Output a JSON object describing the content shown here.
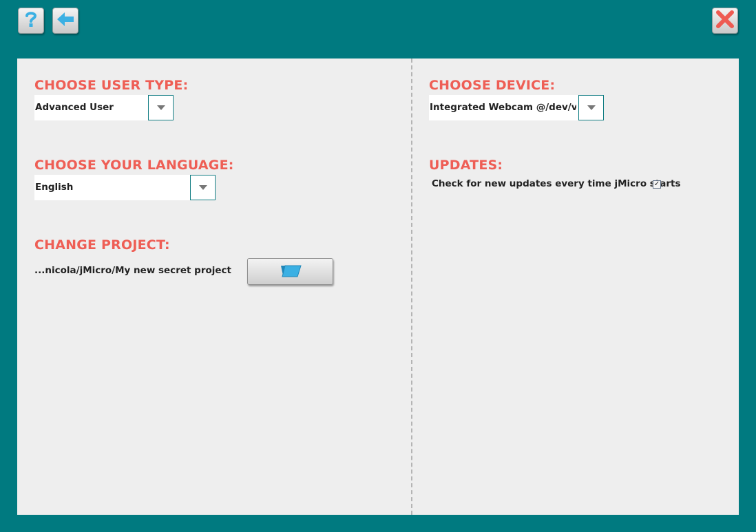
{
  "toolbar": {
    "help_icon": "question-mark-icon",
    "back_icon": "arrow-left-icon",
    "close_icon": "close-x-icon"
  },
  "colors": {
    "background": "#007a80",
    "panel": "#eeeeee",
    "heading": "#ee5e55",
    "icon_blue": "#3bb0e3",
    "close_red": "#ee5b52"
  },
  "left": {
    "user_type": {
      "heading": "CHOOSE USER TYPE:",
      "selected": "Advanced User"
    },
    "language": {
      "heading": "CHOOSE YOUR LANGUAGE:",
      "selected": "English"
    },
    "project": {
      "heading": "CHANGE PROJECT:",
      "path": "...nicola/jMicro/My new secret project",
      "button_icon": "folder-open-icon"
    }
  },
  "right": {
    "device": {
      "heading": "CHOOSE DEVICE:",
      "selected": "Integrated Webcam @/dev/vi..."
    },
    "updates": {
      "heading": "UPDATES:",
      "check_label": "Check for new updates every time jMicro starts",
      "checked": true,
      "check_mark": "✓"
    }
  }
}
